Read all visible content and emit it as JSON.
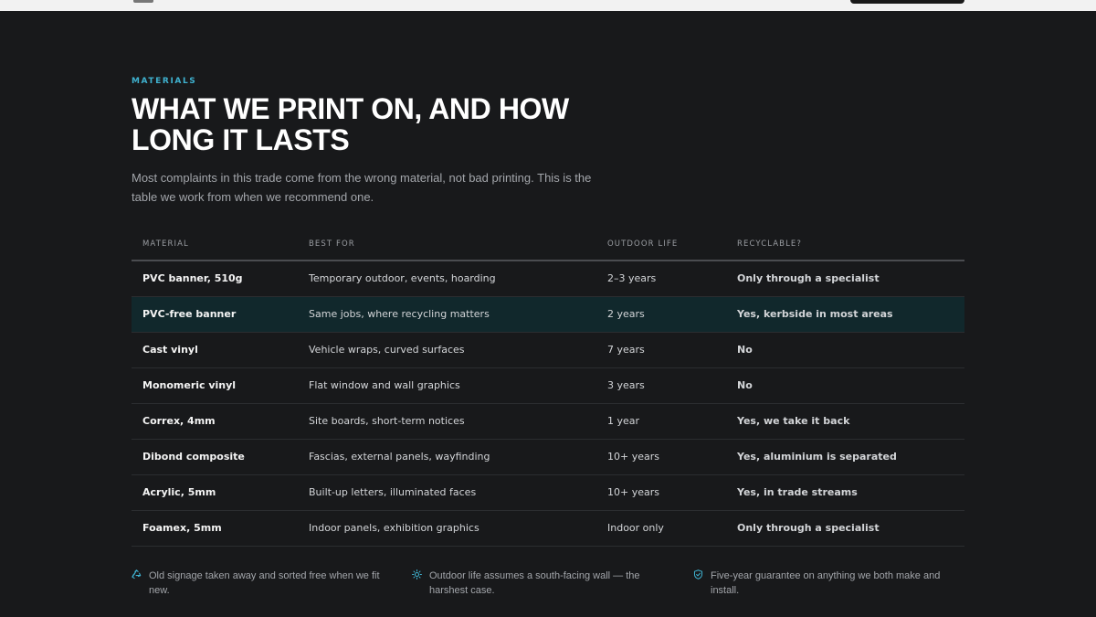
{
  "section": {
    "eyebrow": "MATERIALS",
    "headline": "WHAT WE PRINT ON, AND HOW LONG IT LASTS",
    "intro": "Most complaints in this trade come from the wrong material, not bad printing. This is the table we work from when we recommend one."
  },
  "table": {
    "headers": [
      "MATERIAL",
      "BEST FOR",
      "OUTDOOR LIFE",
      "RECYCLABLE?"
    ],
    "rows": [
      {
        "material": "PVC banner, 510g",
        "best_for": "Temporary outdoor, events, hoarding",
        "life": "2–3 years",
        "recyclable": "Only through a specialist",
        "status": "warn"
      },
      {
        "material": "PVC-free banner",
        "best_for": "Same jobs, where recycling matters",
        "life": "2 years",
        "recyclable": "Yes, kerbside in most areas",
        "status": "yes"
      },
      {
        "material": "Cast vinyl",
        "best_for": "Vehicle wraps, curved surfaces",
        "life": "7 years",
        "recyclable": "No",
        "status": "no"
      },
      {
        "material": "Monomeric vinyl",
        "best_for": "Flat window and wall graphics",
        "life": "3 years",
        "recyclable": "No",
        "status": "no"
      },
      {
        "material": "Correx, 4mm",
        "best_for": "Site boards, short-term notices",
        "life": "1 year",
        "recyclable": "Yes, we take it back",
        "status": "yes"
      },
      {
        "material": "Dibond composite",
        "best_for": "Fascias, external panels, wayfinding",
        "life": "10+ years",
        "recyclable": "Yes, aluminium is separated",
        "status": "yes"
      },
      {
        "material": "Acrylic, 5mm",
        "best_for": "Built-up letters, illuminated faces",
        "life": "10+ years",
        "recyclable": "Yes, in trade streams",
        "status": "warn"
      },
      {
        "material": "Foamex, 5mm",
        "best_for": "Indoor panels, exhibition graphics",
        "life": "Indoor only",
        "recyclable": "Only through a specialist",
        "status": "warn"
      }
    ]
  },
  "notes": [
    {
      "icon": "recycle-icon",
      "text": "Old signage taken away and sorted free when we fit new."
    },
    {
      "icon": "sun-icon",
      "text": "Outdoor life assumes a south-facing wall — the harshest case."
    },
    {
      "icon": "shield-check-icon",
      "text": "Five-year guarantee on anything we both make and install."
    }
  ],
  "colors": {
    "accent": "#3fb2d0",
    "yes": "#3dc792",
    "warn": "#e5b32e",
    "no": "#ef6b6b",
    "highlight_row": "#11282c"
  }
}
